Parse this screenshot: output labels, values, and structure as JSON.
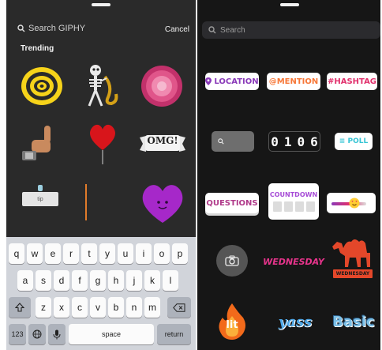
{
  "gif_panel": {
    "search_placeholder": "Search GIPHY",
    "cancel_label": "Cancel",
    "section_title": "Trending",
    "gifs": [
      {
        "icon": "yellow-spiral"
      },
      {
        "icon": "skeleton-saxophone"
      },
      {
        "icon": "pink-flower"
      },
      {
        "icon": "thumbs-up"
      },
      {
        "icon": "red-balloon-heart"
      },
      {
        "icon": "omg-banner",
        "text": "OMG!"
      },
      {
        "icon": "tip-sign",
        "text": "tip"
      },
      {
        "icon": "orange-line"
      },
      {
        "icon": "purple-heart"
      }
    ]
  },
  "keyboard": {
    "row1": [
      "q",
      "w",
      "e",
      "r",
      "t",
      "y",
      "u",
      "i",
      "o",
      "p"
    ],
    "row2": [
      "a",
      "s",
      "d",
      "f",
      "g",
      "h",
      "j",
      "k",
      "l"
    ],
    "row3": [
      "z",
      "x",
      "c",
      "v",
      "b",
      "n",
      "m"
    ],
    "numbers_label": "123",
    "space_label": "space",
    "return_label": "return"
  },
  "sticker_panel": {
    "search_placeholder": "Search",
    "stickers": {
      "location": "LOCATION",
      "mention": "@MENTION",
      "hashtag": "#HASHTAG",
      "countdown_digits": "0106",
      "poll": "≡ POLL",
      "questions": "QUESTIONS",
      "countdown": "COUNTDOWN",
      "wednesday": "WEDNESDAY",
      "camel_caption": "WEDNESDAY",
      "lit": "lit",
      "yass": "yass",
      "basic": "Basic"
    }
  },
  "colors": {
    "location": "#8a3ab9",
    "mention": "#f77737",
    "hashtag": "#e1306c",
    "poll": "#35c4d4",
    "questions": "#b03a8a",
    "wednesday": "#e8348c",
    "camel": "#e4472a"
  }
}
